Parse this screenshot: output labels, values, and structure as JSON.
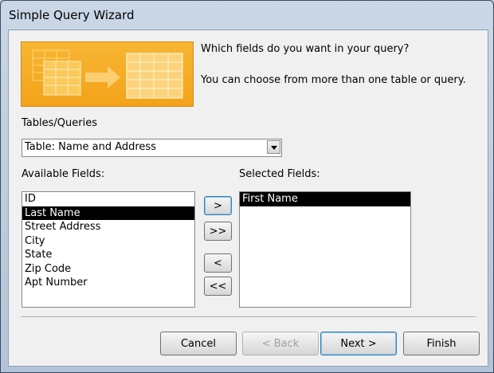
{
  "window": {
    "title": "Simple Query Wizard"
  },
  "intro": {
    "question": "Which fields do you want in your query?",
    "hint": "You can choose from more than one table or query."
  },
  "tables": {
    "label": "Tables/Queries",
    "selected": "Table: Name and Address"
  },
  "available": {
    "label": "Available Fields:",
    "items": [
      "ID",
      "Last Name",
      "Street Address",
      "City",
      "State",
      "Zip Code",
      "Apt Number"
    ],
    "selected_index": 1
  },
  "selected": {
    "label": "Selected Fields:",
    "items": [
      "First Name"
    ],
    "selected_index": 0
  },
  "move_buttons": {
    "add": ">",
    "add_all": ">>",
    "remove": "<",
    "remove_all": "<<"
  },
  "footer": {
    "cancel": "Cancel",
    "back": "< Back",
    "next": "Next >",
    "finish": "Finish"
  }
}
